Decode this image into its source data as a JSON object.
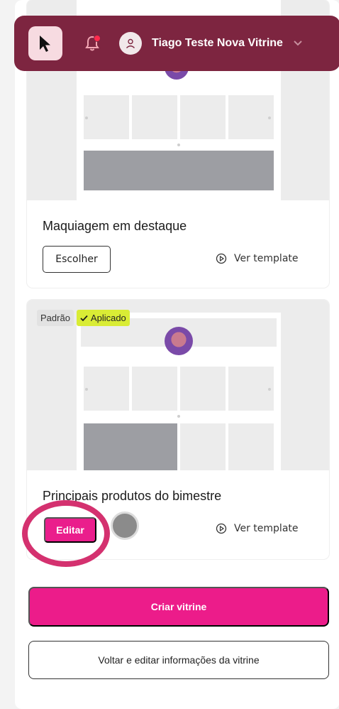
{
  "header": {
    "user_name": "Tiago Teste Nova Vitrine",
    "bar_color": "#7d2540",
    "notification_dot": true
  },
  "templates": [
    {
      "title": "Maquiagem em destaque",
      "primary_label": "Escolher",
      "preview_label": "Ver template"
    },
    {
      "badge_default": "Padrão",
      "badge_applied": "Aplicado",
      "title": "Principais produtos do bimestre",
      "primary_label": "Editar",
      "preview_label": "Ver template"
    }
  ],
  "actions": {
    "create_label": "Criar vitrine",
    "back_label": "Voltar e editar informações da vitrine",
    "accent": "#ec1c8a"
  }
}
